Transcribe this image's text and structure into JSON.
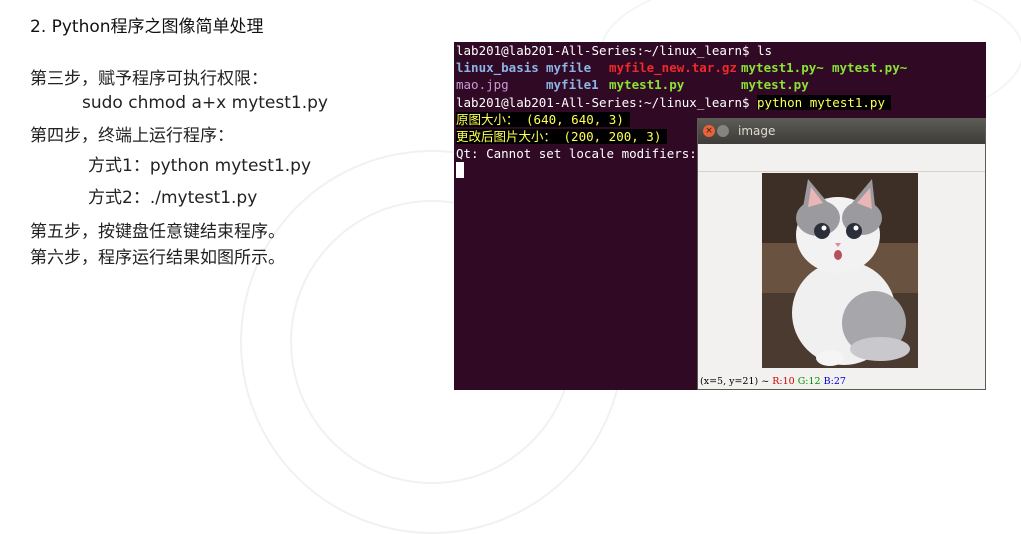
{
  "slide": {
    "title": "2. Python程序之图像简单处理",
    "steps": [
      "第三步，赋予程序可执行权限：",
      "sudo chmod a+x mytest1.py",
      "第四步，终端上运行程序：",
      "方式1：python mytest1.py",
      "方式2：./mytest1.py",
      "第五步，按键盘任意键结束程序。",
      "第六步，程序运行结果如图所示。"
    ]
  },
  "terminal": {
    "background": "#300a24",
    "prompt1": "lab201@lab201-All-Series:~/linux_learn$ ",
    "cmd1": "ls",
    "ls_row1": [
      "linux_basis",
      "myfile",
      "myfile_new.tar.gz",
      "mytest1.py~",
      "mytest.py~"
    ],
    "ls_row2": [
      "mao.jpg",
      "myfile1",
      "mytest1.py",
      "mytest.py"
    ],
    "prompt2": "lab201@lab201-All-Series:~/linux_learn$ ",
    "cmd2": "python mytest1.py",
    "out1": "原图大小： (640, 640, 3)",
    "out2": "更改后图片大小： (200, 200, 3)",
    "out3": "Qt: Cannot set locale modifiers:"
  },
  "image_window": {
    "title": "image",
    "close_glyph": "×",
    "status_prefix": "(x=5, y=21) ~ ",
    "status_r": "R:10",
    "status_g": "G:12",
    "status_b": "B:27",
    "image_icon": "kitten-photo"
  }
}
